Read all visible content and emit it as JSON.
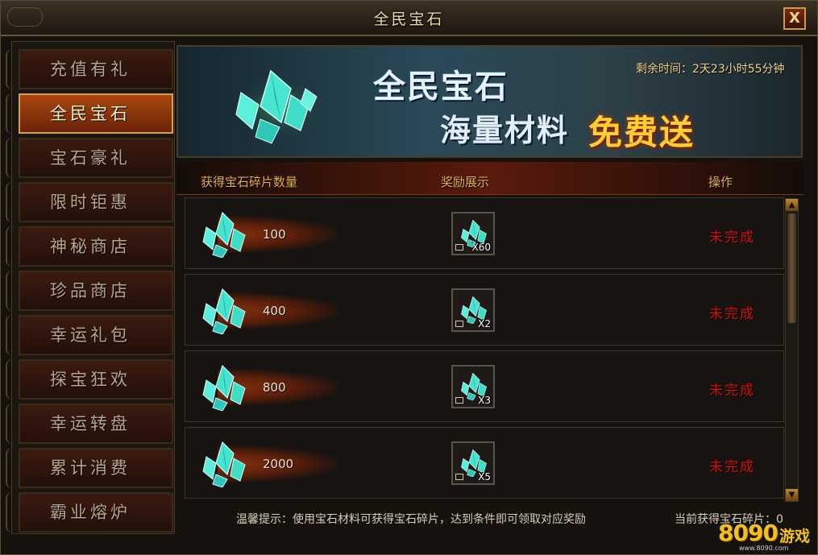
{
  "window": {
    "title": "全民宝石",
    "close_label": "X"
  },
  "sidebar": {
    "items": [
      {
        "label": "充值有礼",
        "active": false
      },
      {
        "label": "全民宝石",
        "active": true
      },
      {
        "label": "宝石豪礼",
        "active": false
      },
      {
        "label": "限时钜惠",
        "active": false
      },
      {
        "label": "神秘商店",
        "active": false
      },
      {
        "label": "珍品商店",
        "active": false
      },
      {
        "label": "幸运礼包",
        "active": false
      },
      {
        "label": "探宝狂欢",
        "active": false
      },
      {
        "label": "幸运转盘",
        "active": false
      },
      {
        "label": "累计消费",
        "active": false
      },
      {
        "label": "霸业熔炉",
        "active": false
      }
    ]
  },
  "banner": {
    "title": "全民宝石",
    "subtitle": "海量材料",
    "free_text": "免费送",
    "timer": "剩余时间：2天23小时55分钟"
  },
  "table": {
    "headers": [
      "获得宝石碎片数量",
      "奖励展示",
      "操作"
    ],
    "rows": [
      {
        "count": "100",
        "reward_qty": "X60",
        "status": "未完成"
      },
      {
        "count": "400",
        "reward_qty": "X2",
        "status": "未完成"
      },
      {
        "count": "800",
        "reward_qty": "X3",
        "status": "未完成"
      },
      {
        "count": "2000",
        "reward_qty": "X5",
        "status": "未完成"
      }
    ]
  },
  "footer": {
    "tip": "温馨提示：使用宝石材料可获得宝石碎片，达到条件即可领取对应奖励",
    "current": "当前获得宝石碎片：0"
  },
  "watermark": {
    "number": "8090",
    "text": "游戏",
    "url": "www.8090.com"
  },
  "colors": {
    "accent": "#e7b043",
    "status_incomplete": "#d3120c",
    "gem": "#3fe6d6"
  }
}
